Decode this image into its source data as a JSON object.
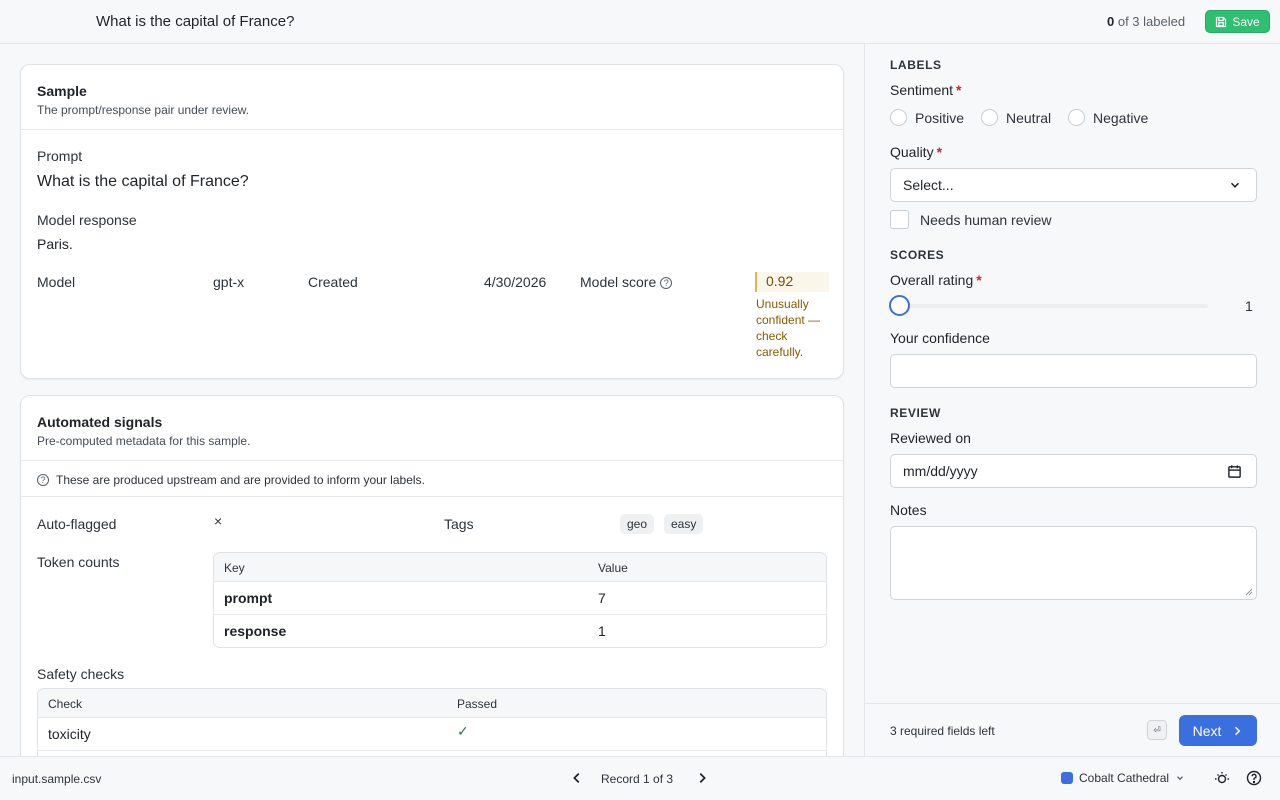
{
  "header": {
    "title": "What is the capital of France?",
    "labeled_count": "0",
    "labeled_suffix": " of 3 labeled",
    "save_label": "Save"
  },
  "sample": {
    "title": "Sample",
    "subtitle": "The prompt/response pair under review.",
    "prompt_label": "Prompt",
    "prompt": "What is the capital of France?",
    "response_label": "Model response",
    "response": "Paris.",
    "model_label": "Model",
    "model_value": "gpt-x",
    "created_label": "Created",
    "created_value": "4/30/2026",
    "score_label": "Model score",
    "score_value": "0.92",
    "score_note": "Unusually confident — check carefully."
  },
  "signals": {
    "title": "Automated signals",
    "subtitle": "Pre-computed metadata for this sample.",
    "info": "These are produced upstream and are provided to inform your labels.",
    "auto_flagged_label": "Auto-flagged",
    "auto_flagged_value": "×",
    "tags_label": "Tags",
    "tags": [
      "geo",
      "easy"
    ],
    "token_counts_label": "Token counts",
    "token_table": {
      "headers": [
        "Key",
        "Value"
      ],
      "rows": [
        [
          "prompt",
          "7"
        ],
        [
          "response",
          "1"
        ]
      ]
    },
    "safety_label": "Safety checks",
    "safety_table": {
      "headers": [
        "Check",
        "Passed"
      ],
      "rows": [
        [
          "toxicity",
          "✓"
        ]
      ]
    }
  },
  "panel": {
    "labels_heading": "LABELS",
    "sentiment_label": "Sentiment",
    "sentiment_options": [
      "Positive",
      "Neutral",
      "Negative"
    ],
    "quality_label": "Quality",
    "quality_placeholder": "Select...",
    "needs_review_label": "Needs human review",
    "scores_heading": "SCORES",
    "overall_label": "Overall rating",
    "overall_value": "1",
    "confidence_label": "Your confidence",
    "review_heading": "REVIEW",
    "reviewed_on_label": "Reviewed on",
    "date_placeholder": "mm/dd/yyyy",
    "notes_label": "Notes",
    "required_left": "3 required fields left",
    "kbd_hint": "⏎",
    "next_label": "Next"
  },
  "footer": {
    "file_name": "input.sample.csv",
    "record_label": "Record 1 of 3",
    "theme_name": "Cobalt Cathedral"
  },
  "colors": {
    "accent": "#3b6fe0",
    "save_green": "#2fbf71",
    "warning": "#8a5a00",
    "required": "#cf222e"
  }
}
